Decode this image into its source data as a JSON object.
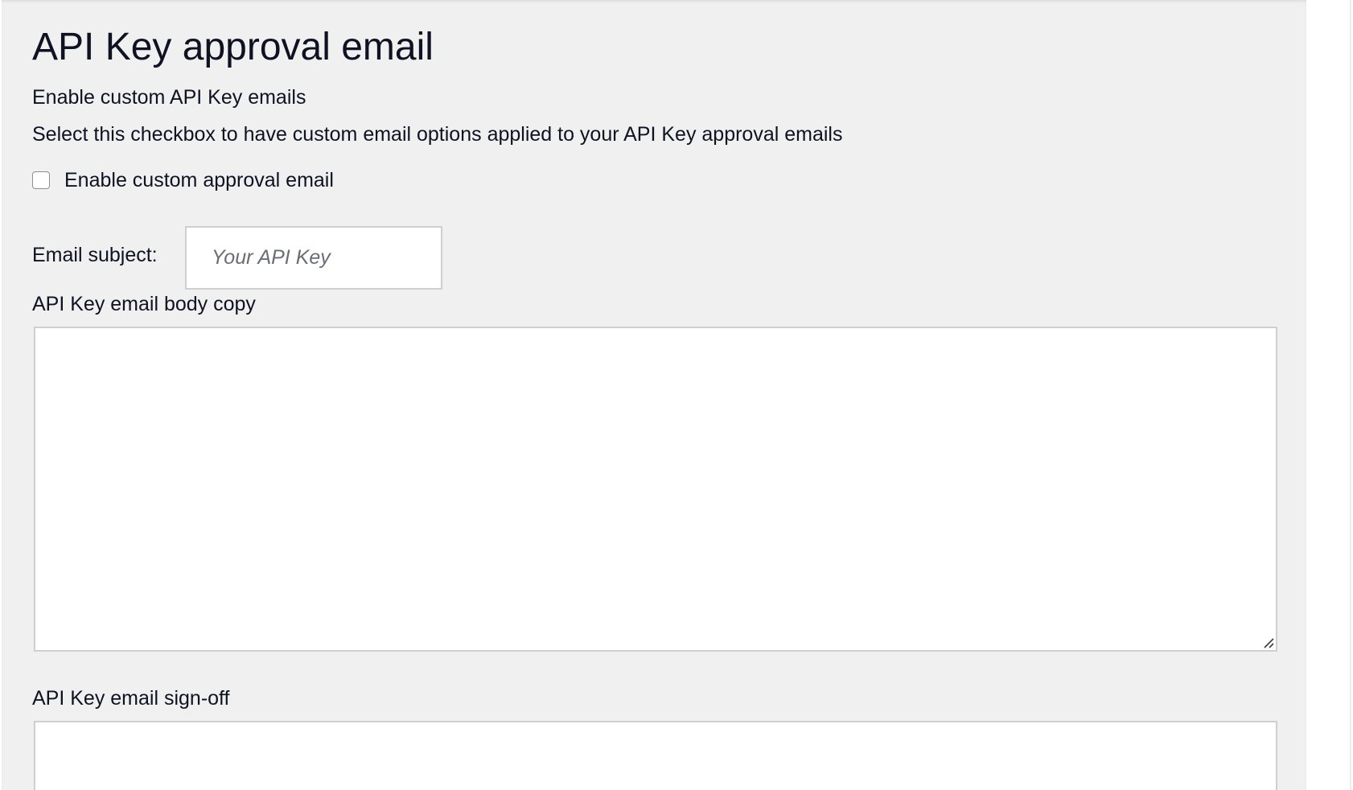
{
  "page": {
    "title": "API Key approval email"
  },
  "custom_emails": {
    "heading": "Enable custom API Key emails",
    "description": "Select this checkbox to have custom email options applied to your API Key approval emails",
    "checkbox_label": "Enable custom approval email",
    "checkbox_checked": false
  },
  "email_subject": {
    "label": "Email subject:",
    "placeholder": "Your API Key",
    "value": ""
  },
  "body_copy": {
    "label": "API Key email body copy",
    "value": ""
  },
  "sign_off": {
    "label": "API Key email sign-off",
    "value": ""
  },
  "colors": {
    "panel_background": "#f0f0f0",
    "text": "#0f1222",
    "field_border": "#cfcfcf",
    "placeholder": "#6a6d76"
  }
}
